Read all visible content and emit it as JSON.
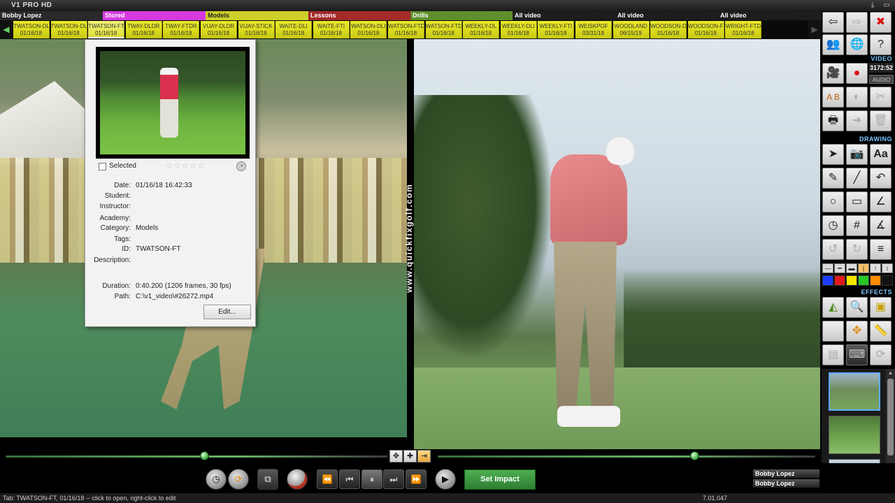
{
  "app": {
    "title": "V1 PRO HD",
    "version": "7.01.047"
  },
  "window_buttons": [
    "⤓",
    "▭"
  ],
  "categories": [
    {
      "label": "Bobby Lopez",
      "color": "#2a2a2a",
      "text": "#ffffff"
    },
    {
      "label": "Stored",
      "color": "#d63adf",
      "text": "#ffffff"
    },
    {
      "label": "Models",
      "color": "#cfcf2a",
      "text": "#222222"
    },
    {
      "label": "Lessons",
      "color": "#a52a2a",
      "text": "#ffffff"
    },
    {
      "label": "Drills",
      "color": "#5e8f2c",
      "text": "#ffffff"
    },
    {
      "label": "All video",
      "color": "#1d1d1d",
      "text": "#ffffff"
    },
    {
      "label": "All video",
      "color": "#1d1d1d",
      "text": "#ffffff"
    },
    {
      "label": "All video",
      "color": "#1d1d1d",
      "text": "#ffffff"
    }
  ],
  "tabs": [
    {
      "name": "TWATSON-DL",
      "date": "01/16/18"
    },
    {
      "name": "TWATSON-DL",
      "date": "01/16/18"
    },
    {
      "name": "TWATSON-FT",
      "date": "01/16/18"
    },
    {
      "name": "TWAY-DLDR",
      "date": "01/16/18"
    },
    {
      "name": "TWAY-FTDR",
      "date": "01/16/18"
    },
    {
      "name": "VIJAY-DLDR",
      "date": "01/16/18"
    },
    {
      "name": "VIJAY-STICK",
      "date": "01/16/18"
    },
    {
      "name": "WAITE-DLI",
      "date": "01/16/18"
    },
    {
      "name": "WAITE-FTI",
      "date": "01/16/18"
    },
    {
      "name": "WATSON-DLI",
      "date": "01/16/18"
    },
    {
      "name": "WATSON-FTD",
      "date": "01/16/18"
    },
    {
      "name": "WATSON-FTD",
      "date": "01/16/18"
    },
    {
      "name": "WEEKLY-DL",
      "date": "01/16/18"
    },
    {
      "name": "WEEKLY-DLI",
      "date": "01/16/18"
    },
    {
      "name": "WEEKLY-FTI",
      "date": "01/16/18"
    },
    {
      "name": "WEISKPOF",
      "date": "03/31/18"
    },
    {
      "name": "WOODLAND",
      "date": "06/15/19"
    },
    {
      "name": "WOODSON-DL",
      "date": "01/16/18"
    },
    {
      "name": "WOODSON-FT",
      "date": "01/16/18"
    },
    {
      "name": "WRIGHT-FTD",
      "date": "01/16/18"
    }
  ],
  "active_tab_index": 2,
  "watermark": "www.quickfixgolf.com",
  "popup": {
    "selected_label": "Selected",
    "stars": "☆☆☆☆☆",
    "fields": [
      {
        "key": "Date:",
        "value": "01/16/18 16:42:33"
      },
      {
        "key": "Student:",
        "value": ""
      },
      {
        "key": "Instructor:",
        "value": ""
      },
      {
        "key": "Academy:",
        "value": ""
      },
      {
        "key": "Category:",
        "value": "Models"
      },
      {
        "key": "Tags:",
        "value": ""
      },
      {
        "key": "ID:",
        "value": "TWATSON-FT"
      },
      {
        "key": "Description:",
        "value": ""
      }
    ],
    "duration_key": "Duration:",
    "duration_value": "0:40.200  (1206 frames, 30 fps)",
    "path_key": "Path:",
    "path_value": "C:\\v1_video\\#26272.mp4",
    "edit_label": "Edit..."
  },
  "toolbar": {
    "video_label": "VIDEO",
    "drawing_label": "DRAWING",
    "effects_label": "EFFECTS",
    "timecode": "3172:52",
    "audio_label": "AUDIO",
    "ab_label": "A B",
    "text_tool_label": "Aa",
    "swatch_colors": [
      "#1e3cff",
      "#e01b1b",
      "#f5e600",
      "#28c828",
      "#ff8c00",
      "#111111"
    ]
  },
  "timeline": {
    "left_position": 0.52,
    "right_position": 0.68
  },
  "controls": {
    "set_impact_label": "Set Impact"
  },
  "users": [
    "Bobby Lopez",
    "Bobby Lopez"
  ],
  "status": {
    "text": "Tab: TWATSON-FT, 01/16/18 -- click to open, right-click to edit"
  }
}
